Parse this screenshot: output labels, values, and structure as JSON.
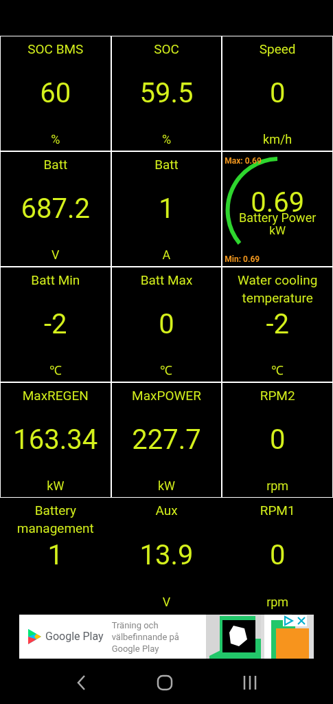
{
  "tiles": [
    {
      "kind": "value",
      "title": "SOC BMS",
      "value": "60",
      "unit": "%"
    },
    {
      "kind": "value",
      "title": "SOC",
      "value": "59.5",
      "unit": "%"
    },
    {
      "kind": "value",
      "title": "Speed",
      "value": "0",
      "unit": "km/h"
    },
    {
      "kind": "value",
      "title": "Batt",
      "value": "687.2",
      "unit": "V"
    },
    {
      "kind": "value",
      "title": "Batt",
      "value": "1",
      "unit": "A"
    },
    {
      "kind": "gauge",
      "title": "Battery Power",
      "value": "0.69",
      "unit": "kW",
      "max": "Max: 0.69",
      "min": "Min: 0.69"
    },
    {
      "kind": "value",
      "title": "Batt Min",
      "value": "-2",
      "unit": "℃"
    },
    {
      "kind": "value",
      "title": "Batt Max",
      "value": "0",
      "unit": "℃"
    },
    {
      "kind": "value",
      "title": "Water cooling temperature",
      "value": "-2",
      "unit": "℃"
    },
    {
      "kind": "value",
      "title": "MaxREGEN",
      "value": "163.34",
      "unit": "kW"
    },
    {
      "kind": "value",
      "title": "MaxPOWER",
      "value": "227.7",
      "unit": "kW"
    },
    {
      "kind": "value",
      "title": "RPM2",
      "value": "0",
      "unit": "rpm"
    },
    {
      "kind": "value",
      "title": "Battery management",
      "value": "1"
    },
    {
      "kind": "value",
      "title": "Aux",
      "value": "13.9",
      "unit": "V"
    },
    {
      "kind": "value",
      "title": "RPM1",
      "value": "0",
      "unit": "rpm"
    }
  ],
  "ad": {
    "brand": "Google Play",
    "text": "Träning och välbefinnande på Google Play"
  }
}
